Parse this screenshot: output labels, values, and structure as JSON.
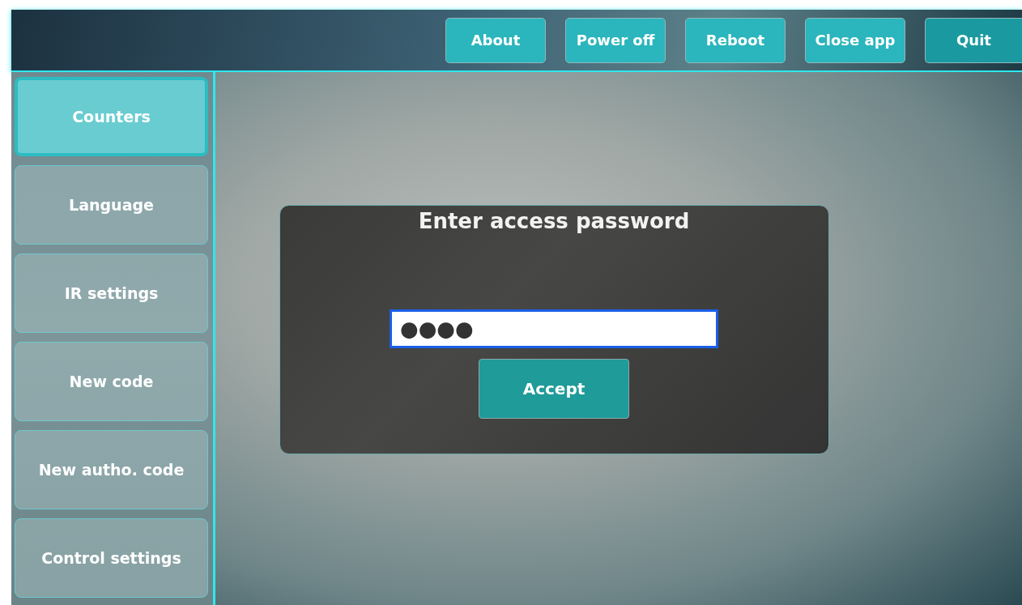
{
  "top_buttons": [
    {
      "label": "About"
    },
    {
      "label": "Power off"
    },
    {
      "label": "Reboot"
    },
    {
      "label": "Close app"
    },
    {
      "label": "Quit"
    }
  ],
  "sidebar": {
    "items": [
      {
        "label": "Counters",
        "selected": true
      },
      {
        "label": "Language",
        "selected": false
      },
      {
        "label": "IR settings",
        "selected": false
      },
      {
        "label": "New code",
        "selected": false
      },
      {
        "label": "New autho. code",
        "selected": false
      },
      {
        "label": "Control settings",
        "selected": false
      }
    ]
  },
  "dialog": {
    "title": "Enter access password",
    "password": {
      "value": "●●●●"
    },
    "button": "Accept"
  }
}
